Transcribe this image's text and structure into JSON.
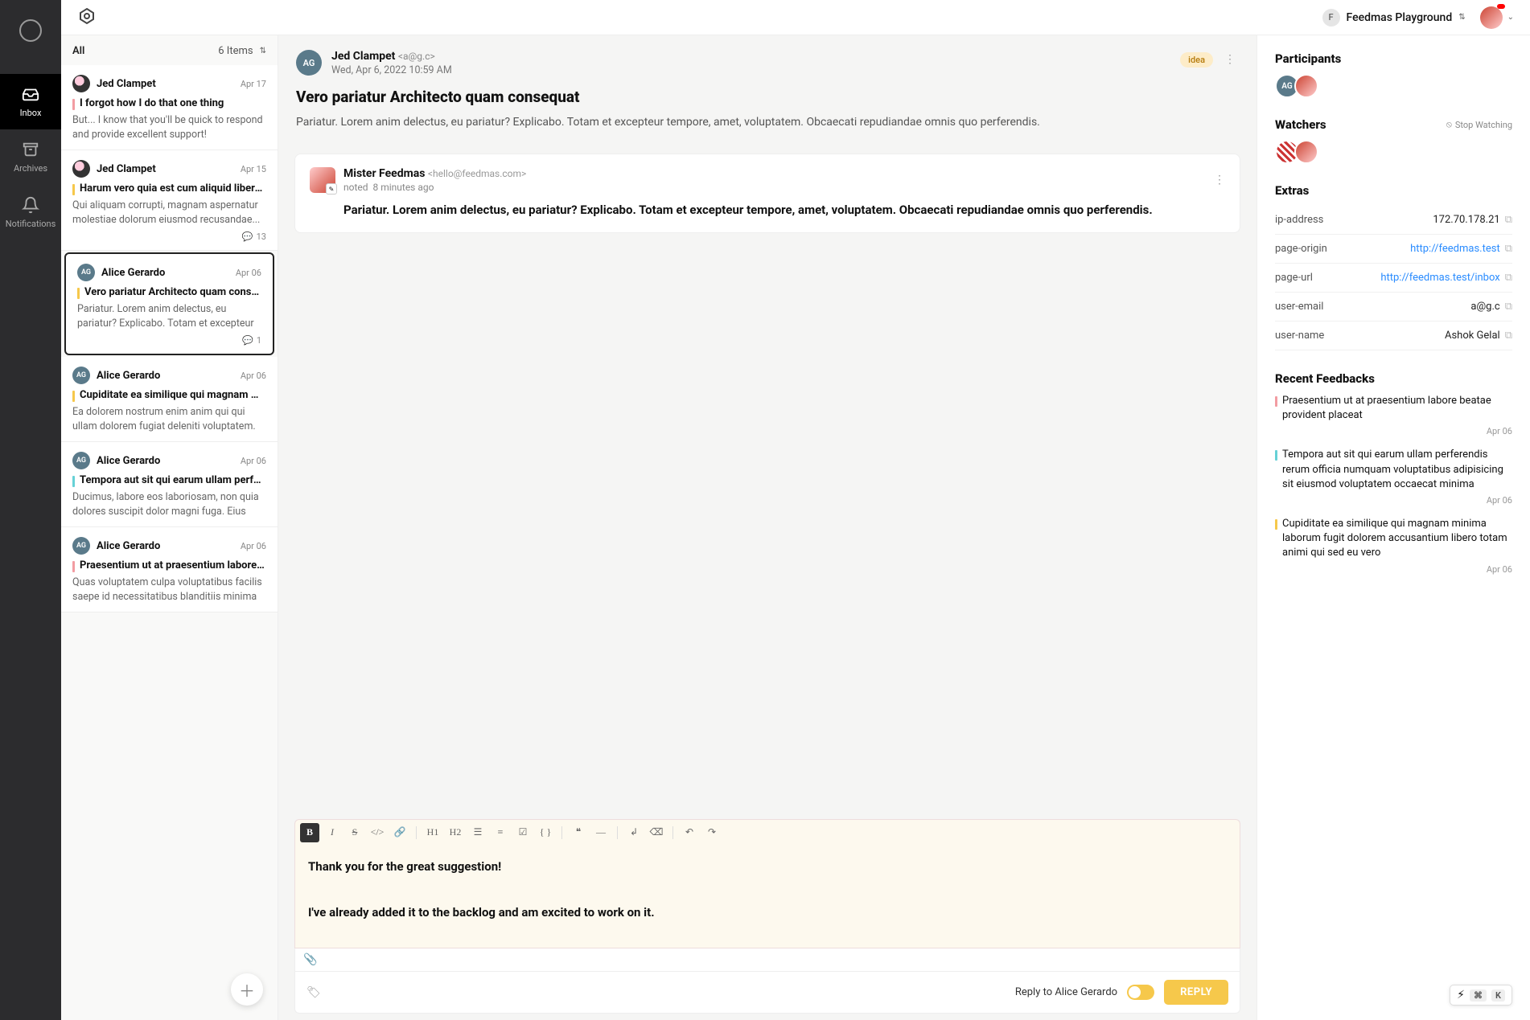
{
  "nav": {
    "inbox": "Inbox",
    "archives": "Archives",
    "notifications": "Notifications"
  },
  "topbar": {
    "workspace_initial": "F",
    "workspace_name": "Feedmas Playground"
  },
  "inbox": {
    "title": "All",
    "count_label": "6 Items",
    "items": [
      {
        "avatar": "",
        "avatar_class": "photo",
        "sender": "Jed Clampet",
        "date": "Apr 17",
        "bar": "#f29ca2",
        "subject": "I forgot how I do that one thing",
        "preview": "But... I know that you'll be quick to respond and provide excellent support!",
        "comments": ""
      },
      {
        "avatar": "",
        "avatar_class": "photo",
        "sender": "Jed Clampet",
        "date": "Apr 15",
        "bar": "#f6c84b",
        "subject": "Harum vero quia est cum aliquid libero ullam ...",
        "preview": "Qui aliquam corrupti, magnam aspernatur molestiae dolorum eiusmod recusandae...",
        "comments": "13"
      },
      {
        "avatar": "AG",
        "avatar_class": "",
        "sender": "Alice Gerardo",
        "date": "Apr 06",
        "bar": "#f6c84b",
        "subject": "Vero pariatur Architecto quam consequat",
        "preview": "Pariatur. Lorem anim delectus, eu pariatur? Explicabo. Totam et excepteur tempore, amet,...",
        "comments": "1",
        "selected": true
      },
      {
        "avatar": "AG",
        "avatar_class": "",
        "sender": "Alice Gerardo",
        "date": "Apr 06",
        "bar": "#f6c84b",
        "subject": "Cupiditate ea similique qui magnam minima la...",
        "preview": "Ea dolorem nostrum enim anim qui qui ullam dolorem fugiat deleniti voluptatem. Nisi et ipsa...",
        "comments": ""
      },
      {
        "avatar": "AG",
        "avatar_class": "",
        "sender": "Alice Gerardo",
        "date": "Apr 06",
        "bar": "#66d1d6",
        "subject": "Tempora aut sit qui earum ullam perferendis r...",
        "preview": "Ducimus, labore eos laboriosam, non quia dolores suscipit dolor magni fuga. Eius placeat, sed...",
        "comments": ""
      },
      {
        "avatar": "AG",
        "avatar_class": "",
        "sender": "Alice Gerardo",
        "date": "Apr 06",
        "bar": "#f29ca2",
        "subject": "Praesentium ut at praesentium labore beatae...",
        "preview": "Quas voluptatem culpa voluptatibus facilis saepe id necessitatibus blanditiis minima magni qui...",
        "comments": ""
      }
    ]
  },
  "detail": {
    "avatar": "AG",
    "sender_name": "Jed Clampet",
    "sender_email": "<a@g.c>",
    "date": "Wed, Apr 6, 2022 10:59 AM",
    "tag": "idea",
    "subject": "Vero pariatur Architecto quam consequat",
    "body": "Pariatur. Lorem anim delectus, eu pariatur? Explicabo. Totam et excepteur tempore, amet, voluptatem. Obcaecati repudiandae omnis quo perferendis.",
    "note": {
      "author": "Mister Feedmas",
      "email": "<hello@feedmas.com>",
      "verb": "noted",
      "time": "8 minutes ago",
      "body": "Pariatur. Lorem anim delectus, eu pariatur? Explicabo. Totam et excepteur tempore, amet, voluptatem. Obcaecati repudiandae omnis quo perferendis."
    }
  },
  "composer": {
    "line1": "Thank you for the great suggestion!",
    "line2": "I've already added it to the backlog and am excited to work on it.",
    "reply_to_label": "Reply to Alice Gerardo",
    "reply_button": "REPLY"
  },
  "right": {
    "participants_h": "Participants",
    "watchers_h": "Watchers",
    "stop_watching": "Stop Watching",
    "extras_h": "Extras",
    "extras": {
      "ip_label": "ip-address",
      "ip_value": "172.70.178.21",
      "origin_label": "page-origin",
      "origin_value": "http://feedmas.test",
      "url_label": "page-url",
      "url_value": "http://feedmas.test/inbox",
      "email_label": "user-email",
      "email_value": "a@g.c",
      "name_label": "user-name",
      "name_value": "Ashok Gelal"
    },
    "recent_h": "Recent Feedbacks",
    "recent": [
      {
        "bar": "#f29ca2",
        "title": "Praesentium ut at praesentium labore beatae provident placeat",
        "date": "Apr 06"
      },
      {
        "bar": "#66d1d6",
        "title": "Tempora aut sit qui earum ullam perferendis rerum officia numquam voluptatibus adipisicing sit eiusmod voluptatem occaecat minima",
        "date": "Apr 06"
      },
      {
        "bar": "#f6c84b",
        "title": "Cupiditate ea similique qui magnam minima laborum fugit dolorem accusantium libero totam animi qui sed eu vero",
        "date": "Apr 06"
      }
    ]
  },
  "kbd": {
    "bolt": "⚡︎",
    "cmd": "⌘",
    "k": "K"
  }
}
